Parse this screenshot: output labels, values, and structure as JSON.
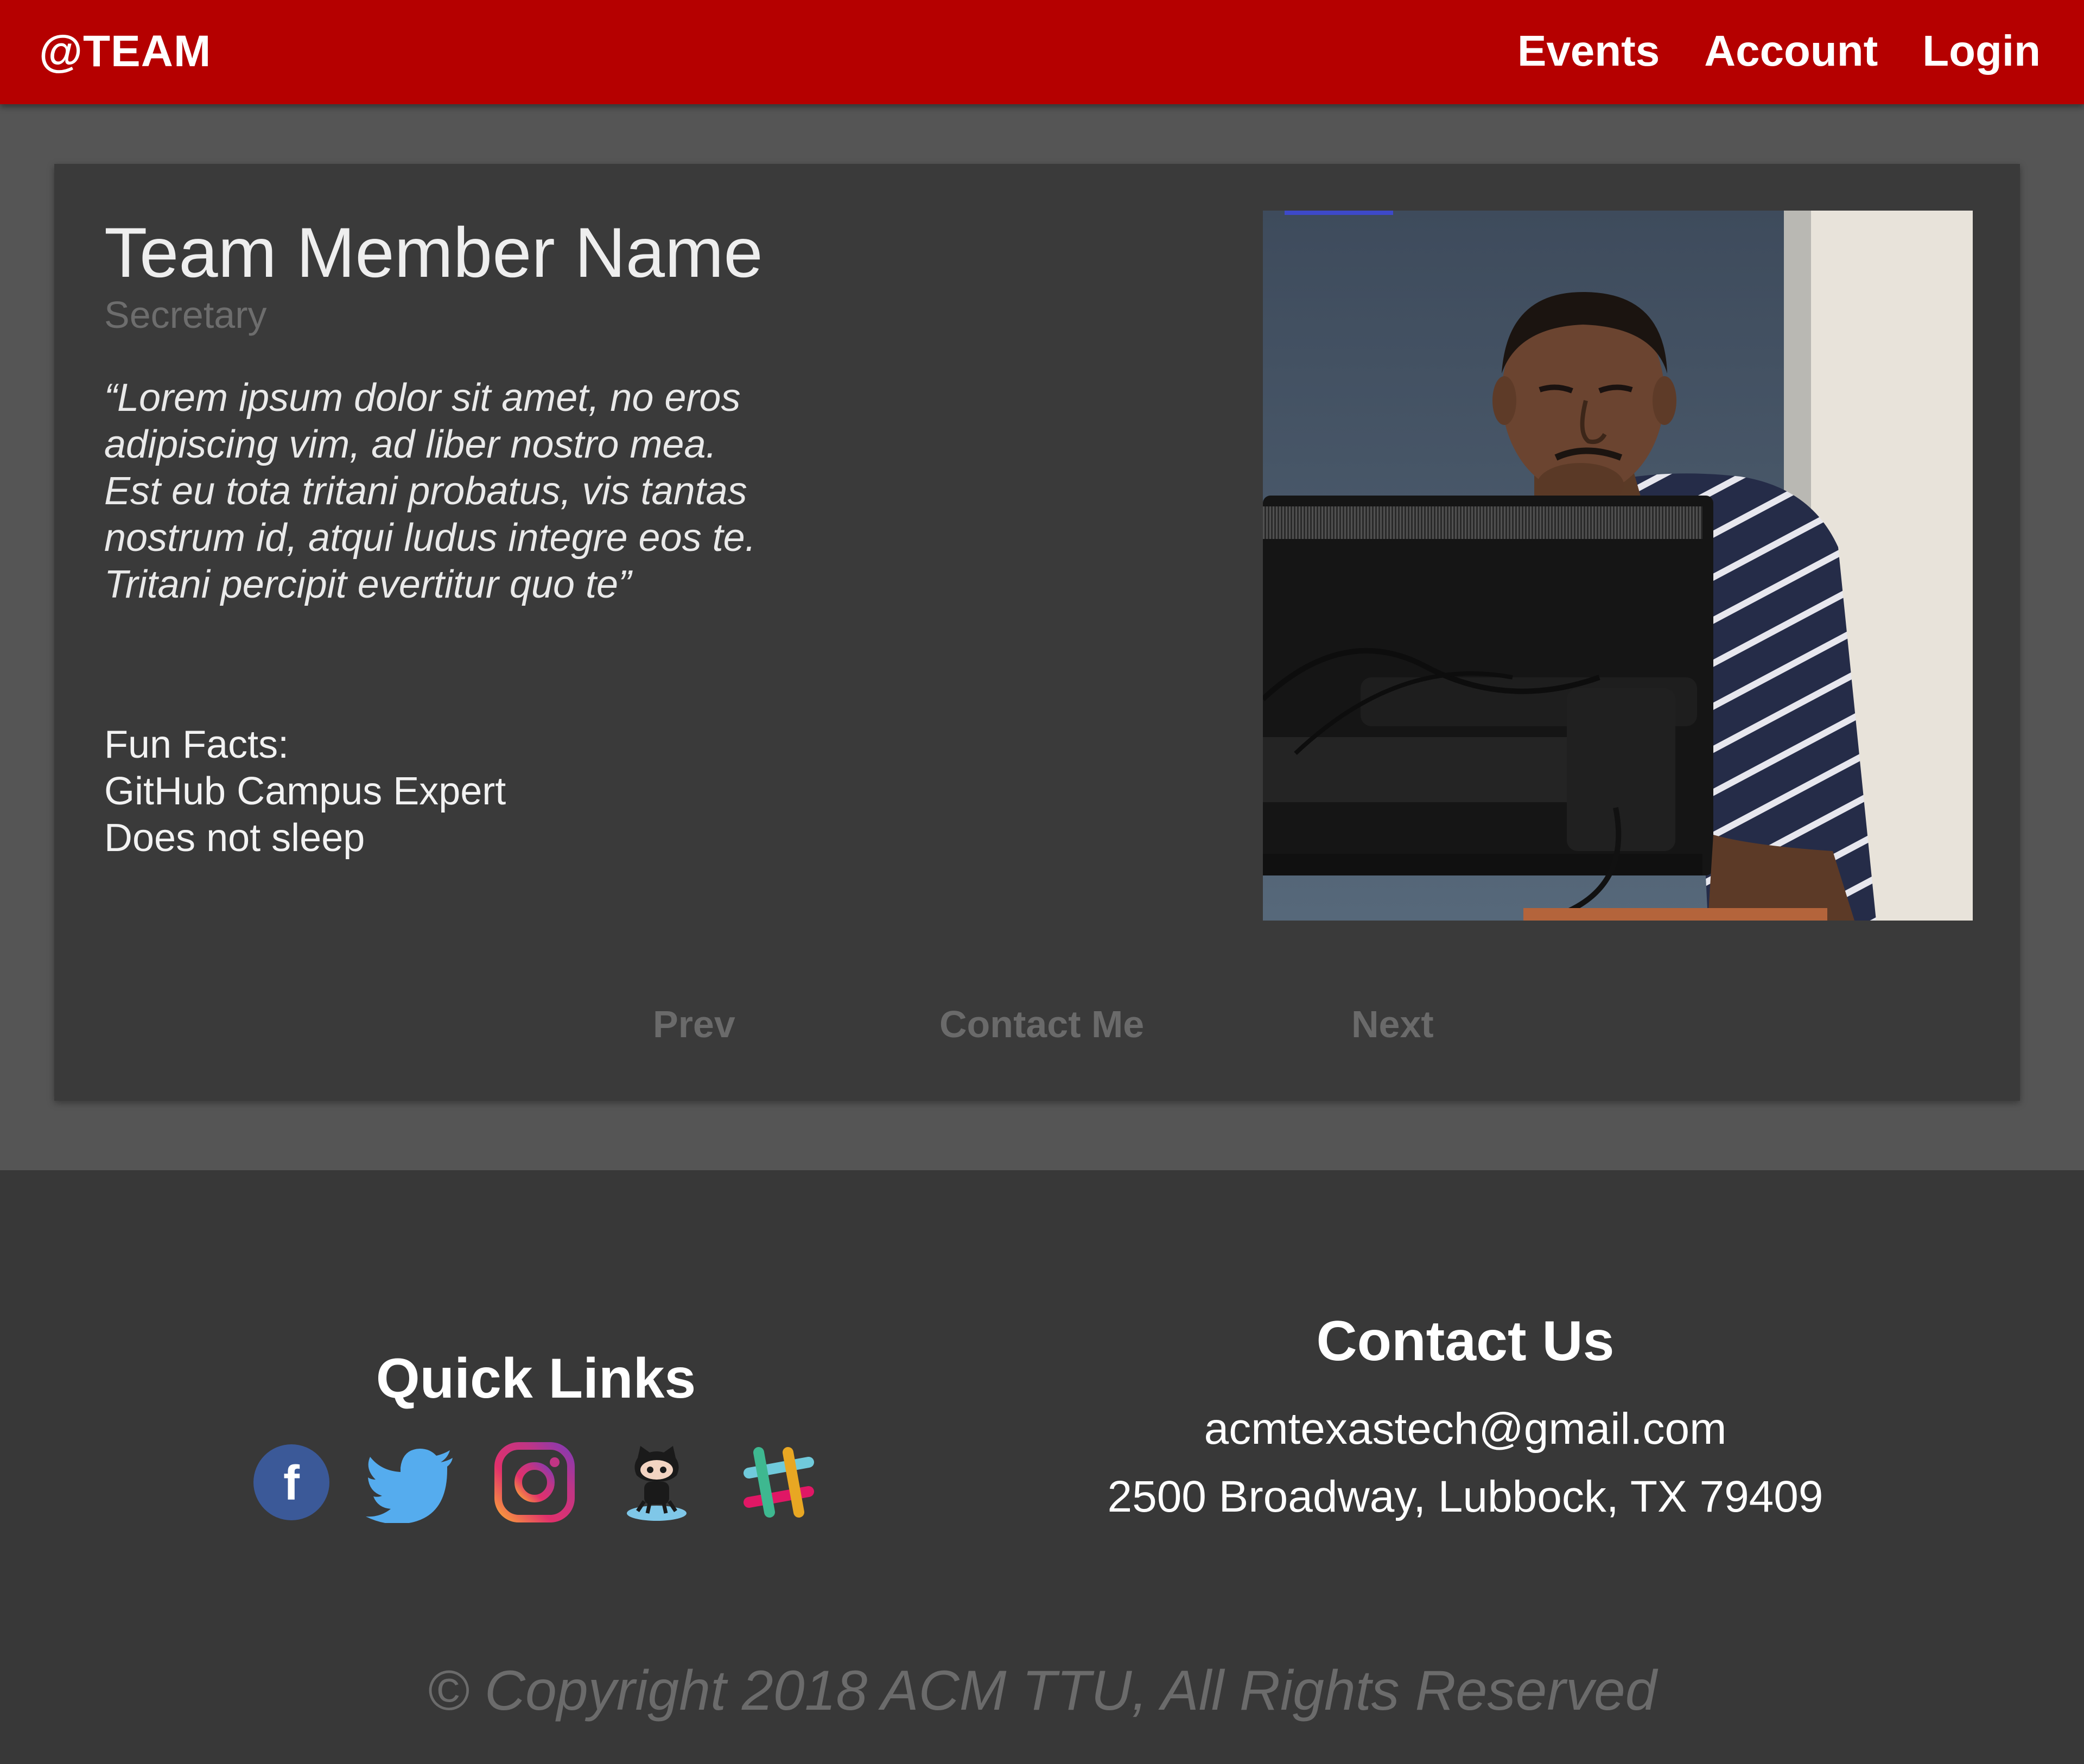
{
  "header": {
    "brand": "@TEAM",
    "nav": [
      "Events",
      "Account",
      "Login"
    ],
    "background_color": "#b50000"
  },
  "member": {
    "name": "Team Member Name",
    "role": "Secretary",
    "quote_lines": [
      "“Lorem ipsum dolor sit amet, no eros",
      "adipiscing vim, ad liber nostro mea.",
      "Est eu tota tritani probatus, vis tantas",
      "nostrum id, atqui ludus integre eos te.",
      "Tritani percipit evertitur quo te”"
    ],
    "fun_facts_label": "Fun Facts:",
    "fun_facts": [
      "GitHub Campus Expert",
      "Does not sleep"
    ],
    "photo_icon": "member-photo"
  },
  "card_actions": {
    "prev": "Prev",
    "contact": "Contact Me",
    "next": "Next"
  },
  "footer": {
    "quick_links_title": "Quick Links",
    "social_icons": [
      "facebook-icon",
      "twitter-icon",
      "instagram-icon",
      "github-icon",
      "slack-icon"
    ],
    "contact_title": "Contact Us",
    "email": "acmtexastech@gmail.com",
    "address": "2500 Broadway, Lubbock,  TX 79409",
    "copyright": "© Copyright 2018 ACM TTU, All Rights Reserved"
  },
  "colors": {
    "page_background": "#555555",
    "card_background": "#3a3a3a",
    "footer_background": "#383838",
    "muted_text": "#6b6b6b"
  }
}
